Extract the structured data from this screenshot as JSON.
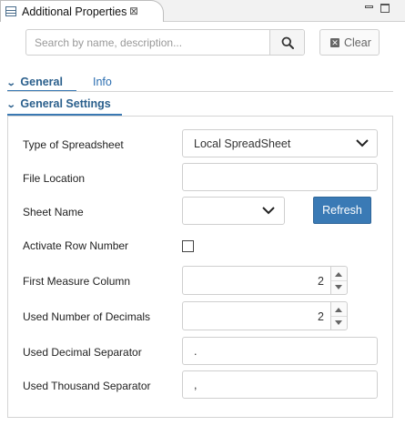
{
  "window": {
    "title": "Additional Properties",
    "close_glyph": "⊠",
    "minimize_icon": "minimize-icon",
    "maximize_icon": "maximize-icon"
  },
  "search": {
    "placeholder": "Search by name, description...",
    "value": "",
    "clear_label": "Clear"
  },
  "tabs": [
    {
      "label": "General",
      "active": true
    },
    {
      "label": "Info",
      "active": false
    }
  ],
  "group": {
    "title": "General Settings"
  },
  "form": {
    "spreadsheet_type": {
      "label": "Type of Spreadsheet",
      "value": "Local SpreadSheet"
    },
    "file_location": {
      "label": "File Location",
      "value": ""
    },
    "sheet_name": {
      "label": "Sheet Name",
      "value": ""
    },
    "refresh_label": "Refresh",
    "activate_row_number": {
      "label": "Activate Row Number",
      "checked": false
    },
    "first_measure_column": {
      "label": "First Measure Column",
      "value": "2"
    },
    "used_decimals": {
      "label": "Used Number of Decimals",
      "value": "2"
    },
    "decimal_separator": {
      "label": "Used Decimal Separator",
      "value": "."
    },
    "thousand_separator": {
      "label": "Used Thousand Separator",
      "value": ","
    }
  },
  "colors": {
    "accent": "#2a5f8c",
    "button_primary": "#3a7ab5"
  }
}
